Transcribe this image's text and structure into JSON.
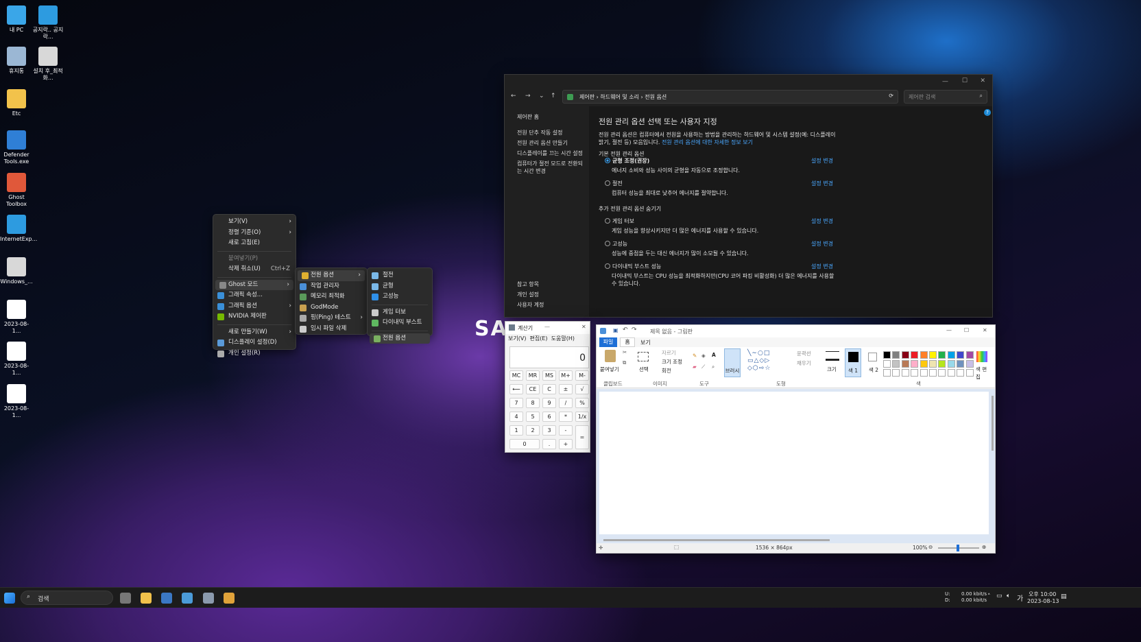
{
  "desktop": {
    "icons": [
      {
        "label": "내 PC",
        "name": "this-pc-icon",
        "color": "#3aa6e8"
      },
      {
        "label": "휴지통",
        "name": "recycle-bin-icon",
        "color": "#9bb7d4"
      },
      {
        "label": "Etc",
        "name": "folder-icon",
        "color": "#f2c24b"
      },
      {
        "label": "Defender Tools.exe",
        "name": "defender-tools-icon",
        "color": "#2f7fd6"
      },
      {
        "label": "Ghost Toolbox",
        "name": "ghost-toolbox-icon",
        "color": "#e0583a"
      },
      {
        "label": "InternetExp...",
        "name": "internet-explorer-icon",
        "color": "#2d9be0"
      },
      {
        "label": "Windows_...",
        "name": "settings-shortcut-icon",
        "color": "#d8d8d8"
      },
      {
        "label": "2023-08-1...",
        "name": "screenshot-file-icon",
        "color": "#ffffff"
      },
      {
        "label": "2023-08-1...",
        "name": "screenshot-file-icon",
        "color": "#ffffff"
      },
      {
        "label": "2023-08-1...",
        "name": "screenshot-file-icon",
        "color": "#ffffff"
      },
      {
        "label": "공지락.. 공지락...",
        "name": "ie-notice-icon",
        "color": "#2d9be0"
      },
      {
        "label": "설치 후_최적화...",
        "name": "optimize-shortcut-icon",
        "color": "#d8d8d8"
      }
    ]
  },
  "context_menu": {
    "items": [
      {
        "label": "보기(V)",
        "arrow": "›"
      },
      {
        "label": "정렬 기준(O)",
        "arrow": "›"
      },
      {
        "label": "새로 고침(E)"
      },
      {
        "label": "붙여넣기(P)"
      },
      {
        "label": "삭제 취소(U)",
        "shortcut": "Ctrl+Z"
      },
      {
        "label": "Ghost 모드",
        "arrow": "›"
      },
      {
        "label": "그래픽 속성..."
      },
      {
        "label": "그래픽 옵션",
        "arrow": "›"
      },
      {
        "label": "NVIDIA 제어판"
      },
      {
        "label": "새로 만들기(W)",
        "arrow": "›"
      },
      {
        "label": "디스플레이 설정(D)"
      },
      {
        "label": "개인 설정(R)"
      }
    ]
  },
  "ghost_submenu": {
    "items": [
      {
        "label": "전원 옵션",
        "arrow": "›"
      },
      {
        "label": "작업 관리자"
      },
      {
        "label": "메모리 최적화"
      },
      {
        "label": "GodMode"
      },
      {
        "label": "핑(Ping) 테스트",
        "arrow": "›"
      },
      {
        "label": "임시 파일 삭제"
      }
    ]
  },
  "power_submenu": {
    "items": [
      {
        "label": "절전"
      },
      {
        "label": "균형"
      },
      {
        "label": "고성능"
      },
      {
        "label": "게임 터보"
      },
      {
        "label": "다이내믹 부스트"
      },
      {
        "label": "전원 옵션"
      }
    ]
  },
  "control_panel": {
    "breadcrumb": [
      "제어판",
      "하드웨어 및 소리",
      "전원 옵션"
    ],
    "search_placeholder": "제어판 검색",
    "sidebar": {
      "home": "제어판 홈",
      "links": [
        "전원 단추 작동 설정",
        "전원 관리 옵션 만들기",
        "디스플레이를 끄는 시간 설정",
        "컴퓨터가 절전 모드로 전환되는 시간 변경"
      ],
      "see_also": [
        "참고 항목",
        "개인 설정",
        "사용자 계정"
      ]
    },
    "heading": "전원 관리 옵션 선택 또는 사용자 지정",
    "desc": "전원 관리 옵션은 컴퓨터에서 전원을 사용하는 방법을 관리하는 하드웨어 및 시스템 설정(예: 디스플레이 밝기, 절전 등) 모음입니다. ",
    "desc_link": "전원 관리 옵션에 대한 자세한 정보 보기",
    "basic_label": "기본 전원 관리 옵션",
    "extra_label": "추가 전원 관리 옵션 숨기기",
    "change_label": "설정 변경",
    "plans": [
      {
        "name": "균형 조정(권장)",
        "desc": "에너지 소비와 성능 사이의 균형을 자동으로 조정합니다.",
        "selected": true
      },
      {
        "name": "절전",
        "desc": "컴퓨터 성능을 최대로 낮추어 에너지를 절약합니다.",
        "selected": false
      },
      {
        "name": "게임 터보",
        "desc": "게임 성능을 향상시키지만 더 많은 에너지를 사용할 수 있습니다.",
        "selected": false
      },
      {
        "name": "고성능",
        "desc": "성능에 중점을 두는 대신 에너지가 많이 소모될 수 있습니다.",
        "selected": false
      },
      {
        "name": "다이내믹 부스트 성능",
        "desc": "다이내믹 부스트는 CPU 성능을 최적화하지만(CPU 코어 파킹 비활성화) 더 많은 에너지를 사용할 수 있습니다.",
        "selected": false
      }
    ]
  },
  "calculator": {
    "title": "계산기",
    "menu": [
      "보기(V)",
      "편집(E)",
      "도움말(H)"
    ],
    "display": "0",
    "memory": [
      "MC",
      "MR",
      "MS",
      "M+",
      "M-"
    ],
    "rows": [
      [
        "⟵",
        "CE",
        "C",
        "±",
        "√"
      ],
      [
        "7",
        "8",
        "9",
        "/",
        "%"
      ],
      [
        "4",
        "5",
        "6",
        "*",
        "1/x"
      ],
      [
        "1",
        "2",
        "3",
        "-"
      ],
      [
        "0",
        ".",
        "+"
      ]
    ],
    "equals": "="
  },
  "paint": {
    "title": "제목 없음 - 그림판",
    "tabs": [
      "파일",
      "홈",
      "보기"
    ],
    "groups": [
      "클립보드",
      "이미지",
      "도구",
      "도형",
      "색"
    ],
    "clipboard": {
      "paste": "붙여넣기"
    },
    "image": {
      "select": "선택",
      "crop": "자르기",
      "resize": "크기 조정",
      "rotate": "회전"
    },
    "brush": "브러시",
    "outline": "윤곽선",
    "fill": "채우기",
    "size": "크기",
    "color1": "색 1",
    "color2": "색 2",
    "edit_colors": "색 편집",
    "status_size": "1536 × 864px",
    "zoom": "100%",
    "palette": [
      "#000000",
      "#7f7f7f",
      "#880015",
      "#ed1c24",
      "#ff7f27",
      "#fff200",
      "#22b14c",
      "#00a2e8",
      "#3f48cc",
      "#a349a4",
      "#ffffff",
      "#c3c3c3",
      "#b97a57",
      "#ffaec9",
      "#ffc90e",
      "#efe4b0",
      "#b5e61d",
      "#99d9ea",
      "#7092be",
      "#c8bfe7"
    ]
  },
  "taskbar": {
    "search": "검색",
    "net_up": "0.00 kbit/s",
    "net_down": "0.00 kbit/s",
    "net_up_label": "U:",
    "net_down_label": "D:",
    "ime": "가",
    "time": "오후 10:00",
    "date": "2023-08-13"
  }
}
